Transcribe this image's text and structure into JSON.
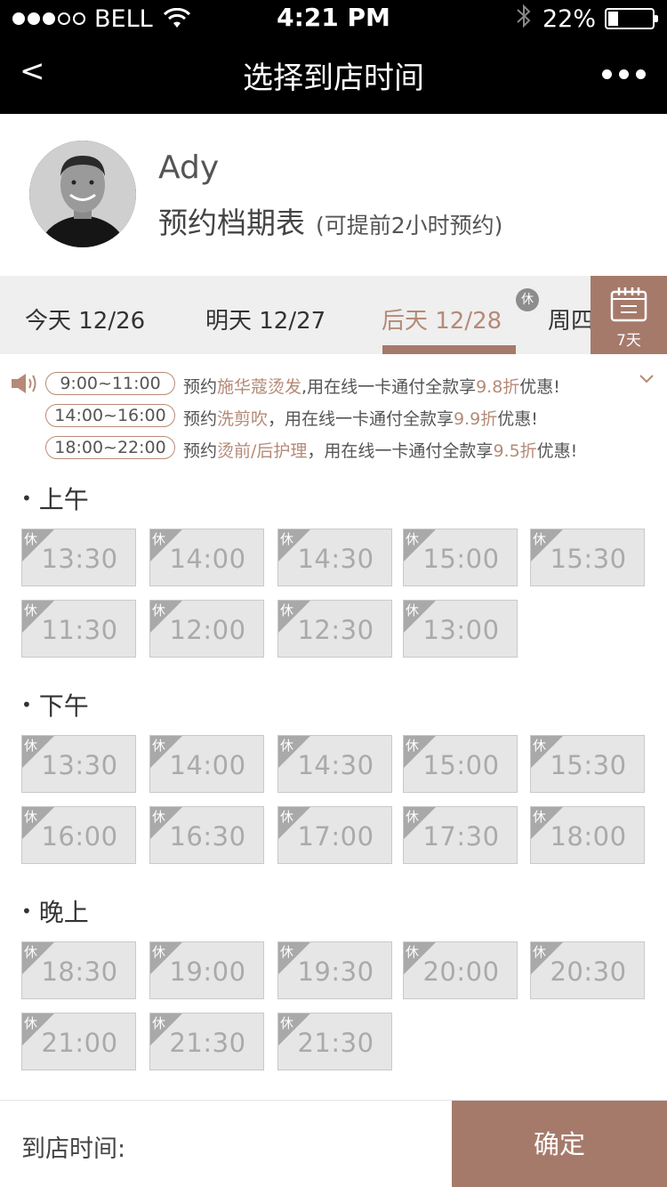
{
  "status_bar": {
    "carrier": "BELL",
    "time": "4:21 PM",
    "battery": "22%",
    "battery_level": 0.22
  },
  "nav": {
    "back": "<",
    "title": "选择到店时间",
    "more_icon": "more-dots-icon"
  },
  "profile": {
    "name": "Ady",
    "schedule_title": "预约档期表",
    "schedule_note": "(可提前2小时预约)"
  },
  "tabs": [
    {
      "label": "今天 12/26"
    },
    {
      "label": "明天 12/27"
    },
    {
      "label": "后天 12/28",
      "active": true,
      "badge": "休"
    },
    {
      "label": "周四"
    }
  ],
  "calendar_button": {
    "label": "7天",
    "icon": "calendar-icon"
  },
  "promos": [
    {
      "time": "9:00~11:00",
      "pre": "预约",
      "service": "施华蔻烫发",
      "mid": ",用在线一卡通付全款享",
      "discount": "9.8折",
      "post": "优惠!"
    },
    {
      "time": "14:00~16:00",
      "pre": "预约",
      "service": "洗剪吹",
      "mid": "，用在线一卡通付全款享",
      "discount": "9.9折",
      "post": "优惠!"
    },
    {
      "time": "18:00~22:00",
      "pre": "预约",
      "service": "烫前/后护理",
      "mid": "，用在线一卡通付全款享",
      "discount": "9.5折",
      "post": "优惠!"
    }
  ],
  "rest_label": "休",
  "sections": [
    {
      "title": "上午",
      "slots": [
        "13:30",
        "14:00",
        "14:30",
        "15:00",
        "15:30",
        "11:30",
        "12:00",
        "12:30",
        "13:00"
      ]
    },
    {
      "title": "下午",
      "slots": [
        "13:30",
        "14:00",
        "14:30",
        "15:00",
        "15:30",
        "16:00",
        "16:30",
        "17:00",
        "17:30",
        "18:00"
      ]
    },
    {
      "title": "晚上",
      "slots": [
        "18:30",
        "19:00",
        "19:30",
        "20:00",
        "20:30",
        "21:00",
        "21:30",
        "21:30"
      ]
    }
  ],
  "bottom": {
    "arrival_label": "到店时间:",
    "confirm": "确定"
  },
  "colors": {
    "accent": "#a67a6b",
    "highlight_text": "#b58a77",
    "slot_bg": "#e6e6e6"
  }
}
